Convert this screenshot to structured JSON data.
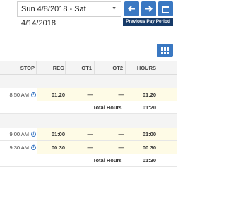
{
  "header": {
    "date_range": "Sun 4/8/2018 - Sat 4/14/2018",
    "prev_tooltip": "Previous Pay Period",
    "prev_icon": "arrow-left-icon",
    "next_icon": "arrow-right-icon",
    "calendar_icon": "calendar-icon",
    "grid_icon": "grid-view-icon",
    "accent": "#3a78c2"
  },
  "table": {
    "columns": [
      "STOP",
      "REG",
      "OT1",
      "OT2",
      "HOURS"
    ],
    "groups": [
      {
        "rows": [
          {
            "stop": "8:50 AM",
            "reg": "01:20",
            "ot1": "—",
            "ot2": "—",
            "hours": "01:20"
          }
        ],
        "total_label": "Total Hours",
        "total": "01:20"
      },
      {
        "rows": [
          {
            "stop": "9:00 AM",
            "reg": "01:00",
            "ot1": "—",
            "ot2": "—",
            "hours": "01:00"
          },
          {
            "stop": "9:30 AM",
            "reg": "00:30",
            "ot1": "—",
            "ot2": "—",
            "hours": "00:30"
          }
        ],
        "total_label": "Total Hours",
        "total": "01:30"
      }
    ]
  }
}
